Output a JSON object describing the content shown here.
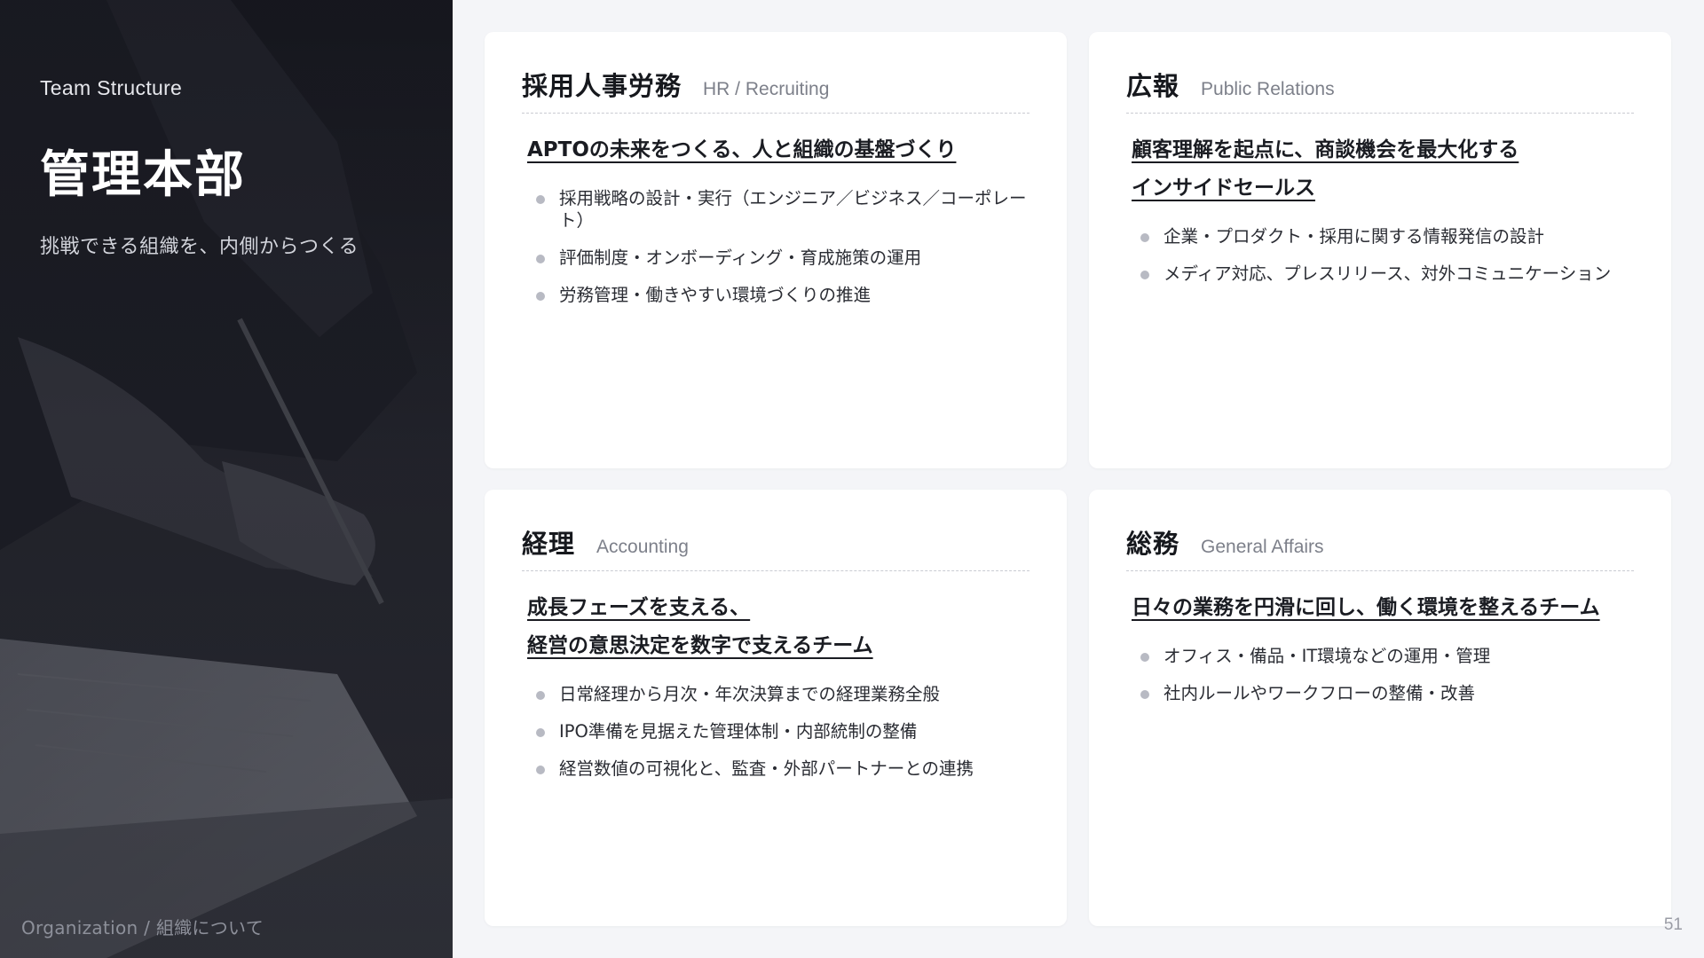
{
  "left_panel": {
    "section_label": "Team Structure",
    "department": "管理本部",
    "tagline": "挑戦できる組織を、内側からつくる",
    "footer": "Organization / 組織について"
  },
  "page_number": "51",
  "cards": [
    {
      "title_jp": "採用人事労務",
      "title_en": "HR / Recruiting",
      "tagline_lines": [
        "APTOの未来をつくる、人と組織の基盤づくり"
      ],
      "items": [
        "採用戦略の設計・実行（エンジニア／ビジネス／コーポレート）",
        "評価制度・オンボーディング・育成施策の運用",
        "労務管理・働きやすい環境づくりの推進"
      ]
    },
    {
      "title_jp": "広報",
      "title_en": "Public Relations",
      "tagline_lines": [
        "顧客理解を起点に、商談機会を最大化する",
        "インサイドセールス"
      ],
      "items": [
        "企業・プロダクト・採用に関する情報発信の設計",
        "メディア対応、プレスリリース、対外コミュニケーション"
      ]
    },
    {
      "title_jp": "経理",
      "title_en": "Accounting",
      "tagline_lines": [
        "成長フェーズを支える、",
        "経営の意思決定を数字で支えるチーム"
      ],
      "items": [
        "日常経理から月次・年次決算までの経理業務全般",
        "IPO準備を見据えた管理体制・内部統制の整備",
        "経営数値の可視化と、監査・外部パートナーとの連携"
      ]
    },
    {
      "title_jp": "総務",
      "title_en": "General Affairs",
      "tagline_lines": [
        "日々の業務を円滑に回し、働く環境を整えるチーム"
      ],
      "items": [
        "オフィス・備品・IT環境などの運用・管理",
        "社内ルールやワークフローの整備・改善"
      ]
    }
  ]
}
